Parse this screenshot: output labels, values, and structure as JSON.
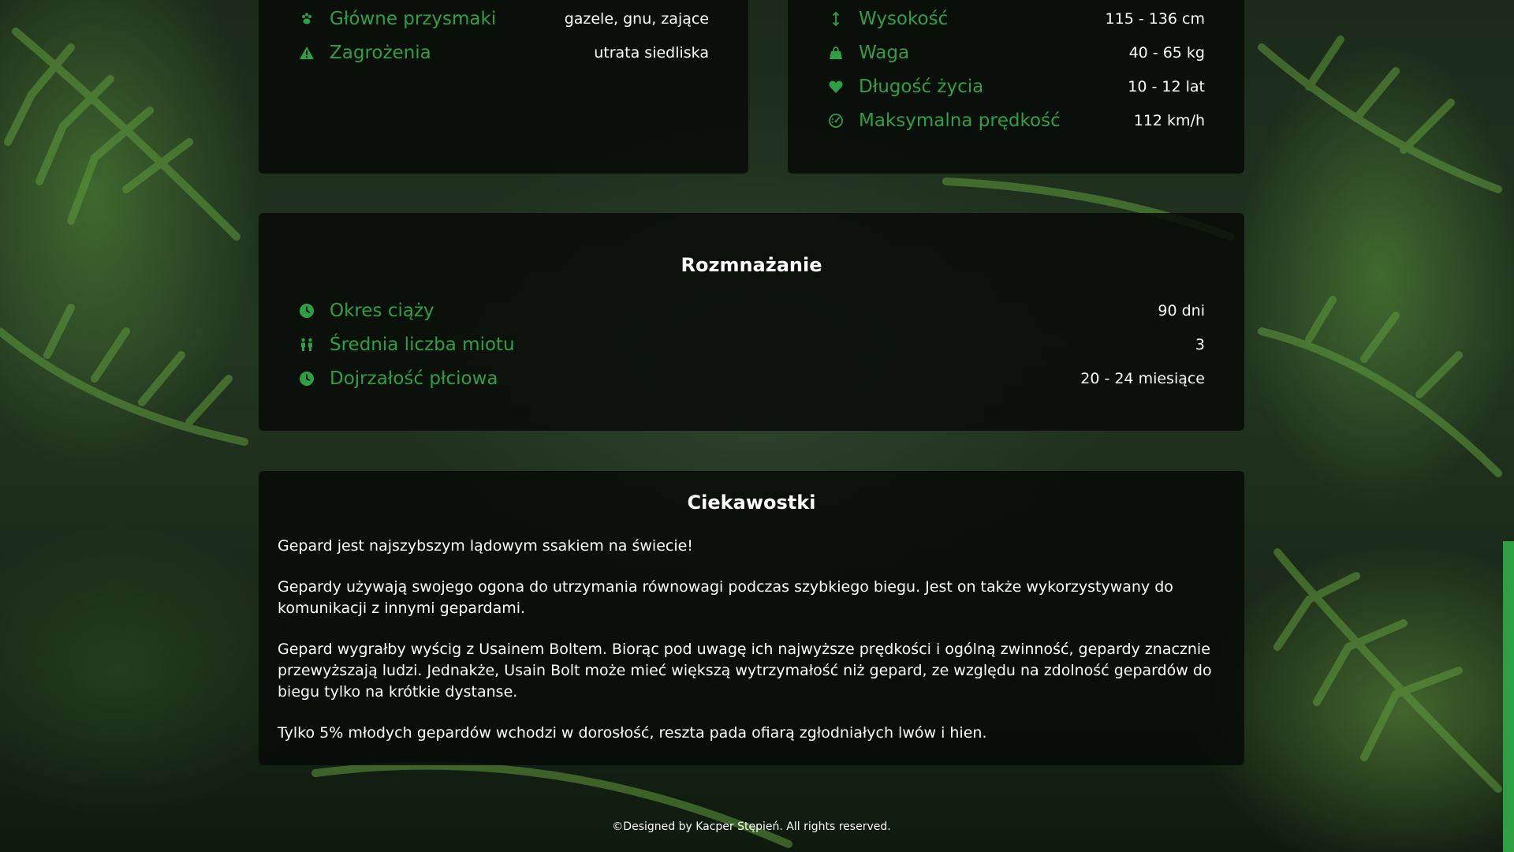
{
  "top_left": {
    "rows": [
      {
        "icon": "paw-icon",
        "label": "Główne przysmaki",
        "value": "gazele, gnu, zające"
      },
      {
        "icon": "warning-icon",
        "label": "Zagrożenia",
        "value": "utrata siedliska"
      }
    ]
  },
  "top_right": {
    "rows": [
      {
        "icon": "height-arrows-icon",
        "label": "Wysokość",
        "value": "115 - 136 cm"
      },
      {
        "icon": "weight-icon",
        "label": "Waga",
        "value": "40 - 65 kg"
      },
      {
        "icon": "heart-icon",
        "label": "Długość życia",
        "value": "10 - 12 lat"
      },
      {
        "icon": "speedometer-icon",
        "label": "Maksymalna prędkość",
        "value": "112 km/h"
      }
    ]
  },
  "reproduction": {
    "title": "Rozmnażanie",
    "rows": [
      {
        "icon": "clock-icon",
        "label": "Okres ciąży",
        "value": "90 dni"
      },
      {
        "icon": "children-icon",
        "label": "Średnia liczba miotu",
        "value": "3"
      },
      {
        "icon": "clock-icon",
        "label": "Dojrzałość płciowa",
        "value": "20 - 24 miesiące"
      }
    ]
  },
  "facts": {
    "title": "Ciekawostki",
    "paragraphs": [
      "Gepard jest najszybszym lądowym ssakiem na świecie!",
      "Gepardy używają swojego ogona do utrzymania równowagi podczas szybkiego biegu. Jest on także wykorzystywany do komunikacji z innymi gepardami.",
      "Gepard wygrałby wyścig z Usainem Boltem. Biorąc pod uwagę ich najwyższe prędkości i ogólną zwinność, gepardy znacznie przewyższają ludzi. Jednakże, Usain Bolt może mieć większą wytrzymałość niż gepard, ze względu na zdolność gepardów do biegu tylko na krótkie dystanse.",
      "Tylko 5% młodych gepardów wchodzi w dorosłość, reszta pada ofiarą zgłodniałych lwów i hien."
    ]
  },
  "footer": {
    "text": "©Designed by Kacper Stępień. All rights reserved."
  },
  "colors": {
    "accent": "#2ea043",
    "card_bg": "#080a08"
  }
}
